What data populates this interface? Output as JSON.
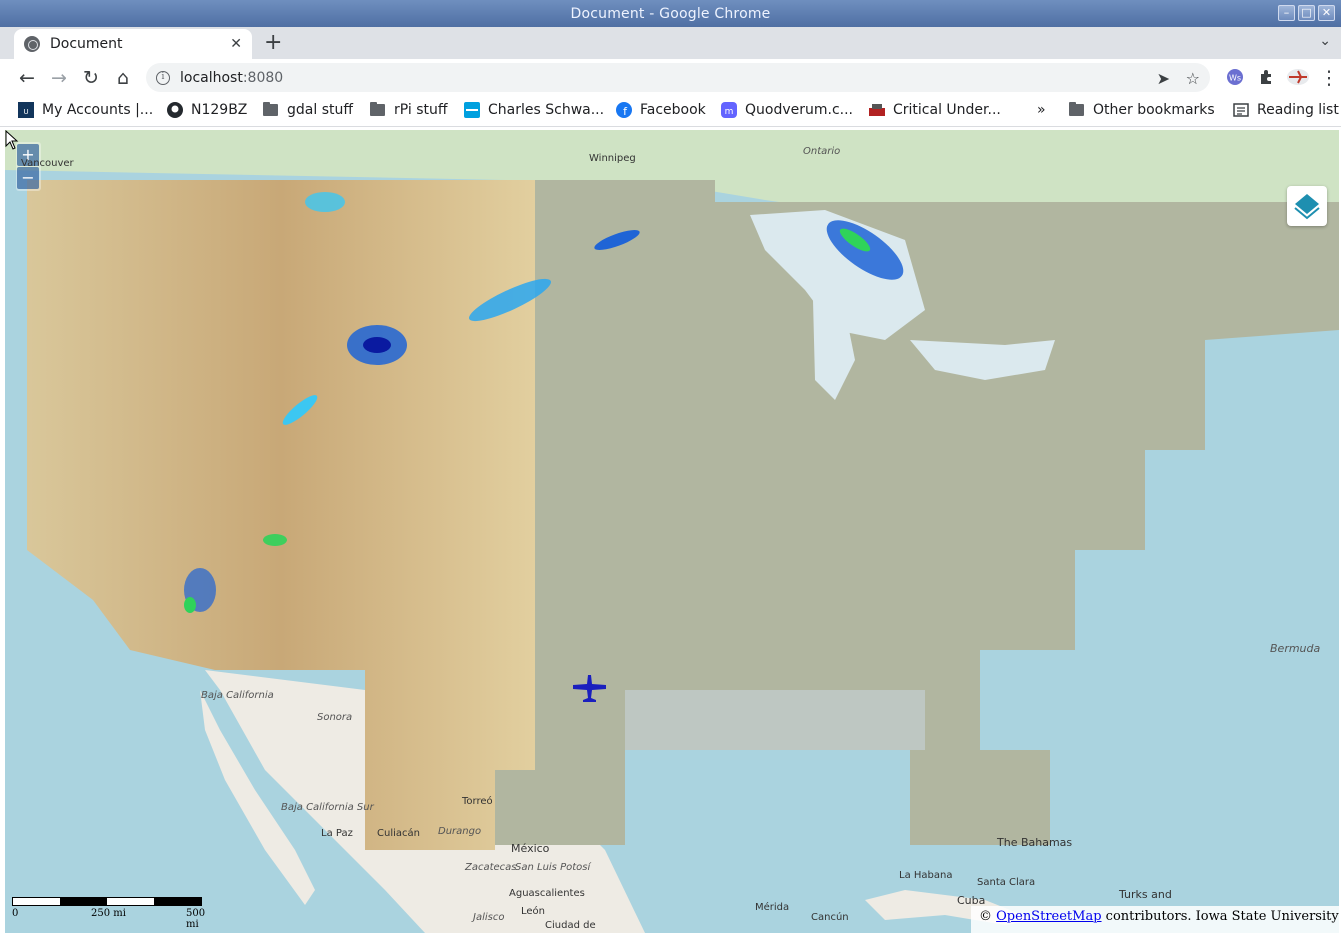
{
  "window": {
    "title": "Document - Google Chrome",
    "controls": [
      "–",
      "□",
      "✕"
    ]
  },
  "tabs": [
    {
      "label": "Document",
      "close": "✕"
    }
  ],
  "new_tab": "+",
  "tab_menu": "⌄",
  "toolbar": {
    "back": "←",
    "forward": "→",
    "reload": "↻",
    "home": "⌂",
    "url_host": "localhost",
    "url_port": ":8080",
    "send_icon": "➤",
    "star_icon": "☆",
    "menu_icon": "⋮"
  },
  "bookmarks": [
    {
      "label": "My Accounts |...",
      "icon": "usaa-icon"
    },
    {
      "label": "N129BZ",
      "icon": "github-icon"
    },
    {
      "label": "gdal stuff",
      "icon": "folder-icon"
    },
    {
      "label": "rPi stuff",
      "icon": "folder-icon"
    },
    {
      "label": "Charles Schwa...",
      "icon": "schwab-icon"
    },
    {
      "label": "Facebook",
      "icon": "facebook-icon"
    },
    {
      "label": "Quodverum.c...",
      "icon": "mastodon-icon"
    },
    {
      "label": "Critical Under...",
      "icon": "site-icon"
    }
  ],
  "bookmarks_overflow": "»",
  "other_bookmarks": "Other bookmarks",
  "reading_list": "Reading list",
  "map": {
    "zoom_in": "+",
    "zoom_out": "−",
    "place_labels": [
      {
        "text": "Vancouver",
        "kind": "city"
      },
      {
        "text": "Winnipeg",
        "kind": "city"
      },
      {
        "text": "Ontario",
        "kind": "region"
      },
      {
        "text": "Bermuda",
        "kind": "region"
      },
      {
        "text": "Baja California",
        "kind": "region"
      },
      {
        "text": "Sonora",
        "kind": "region"
      },
      {
        "text": "Baja California Sur",
        "kind": "region"
      },
      {
        "text": "La Paz",
        "kind": "city"
      },
      {
        "text": "Culiacán",
        "kind": "city"
      },
      {
        "text": "Durango",
        "kind": "region"
      },
      {
        "text": "Torreó",
        "kind": "city"
      },
      {
        "text": "México",
        "kind": "country"
      },
      {
        "text": "Zacatecas",
        "kind": "region"
      },
      {
        "text": "San Luis Potosí",
        "kind": "region"
      },
      {
        "text": "Aguascalientes",
        "kind": "city"
      },
      {
        "text": "León",
        "kind": "city"
      },
      {
        "text": "Jalisco",
        "kind": "region"
      },
      {
        "text": "Ciudad de",
        "kind": "city"
      },
      {
        "text": "Mérida",
        "kind": "city"
      },
      {
        "text": "Cancún",
        "kind": "city"
      },
      {
        "text": "La Habana",
        "kind": "city"
      },
      {
        "text": "Santa Clara",
        "kind": "city"
      },
      {
        "text": "Cuba",
        "kind": "country"
      },
      {
        "text": "Turks and",
        "kind": "region"
      },
      {
        "text": "The Bahamas",
        "kind": "country"
      }
    ],
    "scale": {
      "labels": [
        "0",
        "250 mi",
        "500 mi"
      ]
    },
    "attribution": {
      "prefix": "©",
      "link": "OpenStreetMap",
      "suffix": "contributors. Iowa State University"
    }
  }
}
